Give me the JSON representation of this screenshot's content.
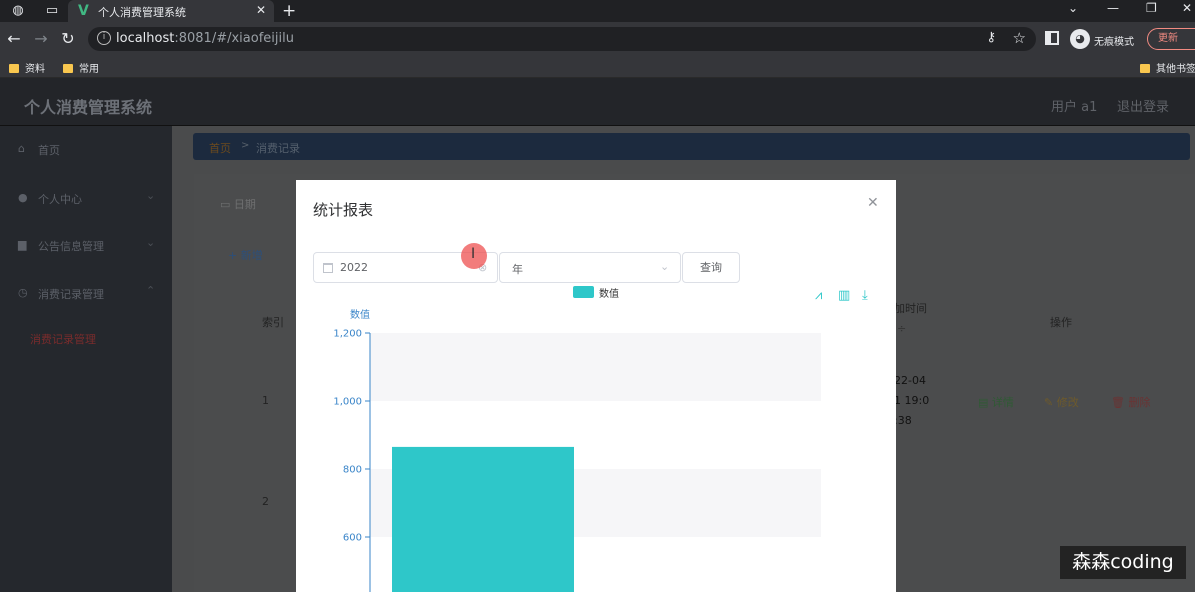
{
  "browser": {
    "tab_title": "个人消费管理系统",
    "url_host": "localhost",
    "url_rest": ":8081/#/xiaofeijilu",
    "incognito_label": "无痕模式",
    "update_label": "更新",
    "bookmarks": [
      "资料",
      "常用"
    ],
    "other_bookmarks": "其他书签"
  },
  "app": {
    "title": "个人消费管理系统",
    "user": "用户 a1",
    "logout": "退出登录"
  },
  "sidebar": {
    "items": [
      {
        "label": "首页",
        "icon": "home-icon"
      },
      {
        "label": "个人中心",
        "icon": "user-icon"
      },
      {
        "label": "公告信息管理",
        "icon": "briefcase-icon"
      },
      {
        "label": "消费记录管理",
        "icon": "clock-icon"
      }
    ],
    "sub_item": "消费记录管理"
  },
  "page": {
    "breadcrumb_home": "首页",
    "breadcrumb_sep": ">",
    "breadcrumb_current": "消费记录",
    "search_label": "日期",
    "add_button": "新增",
    "col_index": "索引",
    "col_time_1": "加时间",
    "col_time_2": "÷",
    "col_ops": "操作",
    "rows": [
      {
        "index": "1",
        "date_1": "22-04",
        "date_2": "1 19:0",
        "date_3": ":38"
      },
      {
        "index": "2"
      }
    ],
    "op_detail": "详情",
    "op_edit": "修改",
    "op_delete": "删除"
  },
  "modal": {
    "title": "统计报表",
    "date_value": "2022",
    "period_value": "年",
    "query_button": "查询"
  },
  "chart_data": {
    "type": "bar",
    "legend": [
      "数值"
    ],
    "ylabel": "数值",
    "yticks": [
      600,
      800,
      1000,
      1200
    ],
    "ylim": [
      500,
      1200
    ],
    "series": [
      {
        "name": "数值",
        "values": [
          865
        ]
      }
    ],
    "color": "#2ec7c9",
    "legend_position": "top-center"
  },
  "watermark": "森森coding"
}
